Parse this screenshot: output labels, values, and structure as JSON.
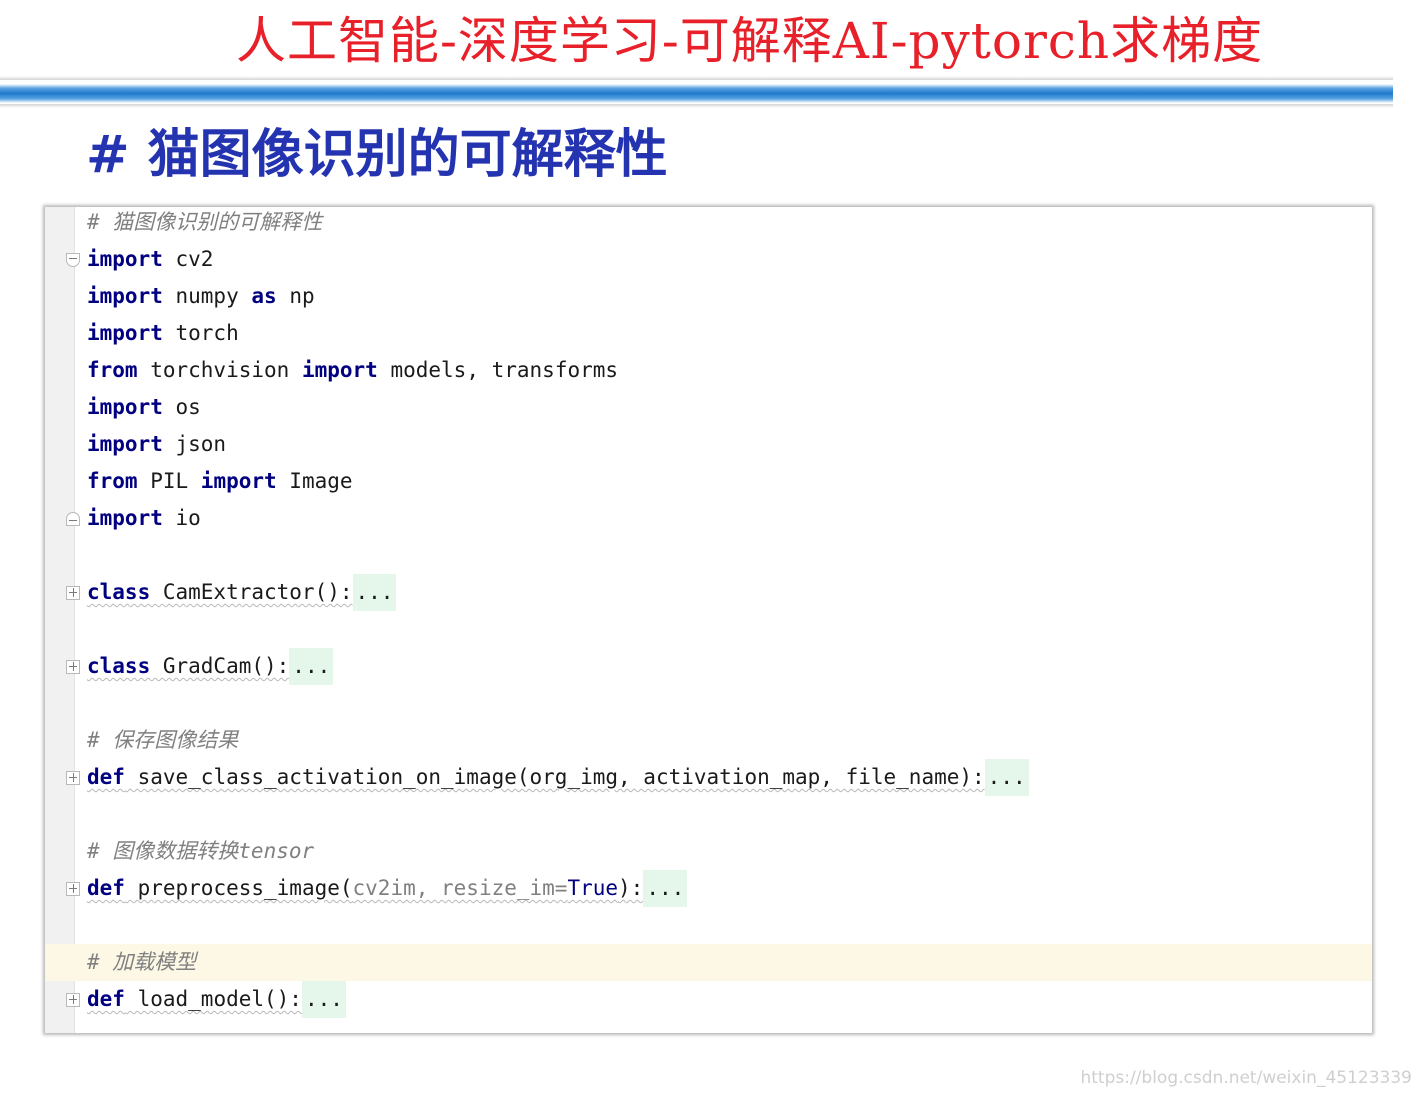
{
  "slide": {
    "title": "人工智能-深度学习-可解释AI-pytorch求梯度",
    "section_heading": "# 猫图像识别的可解释性",
    "watermark": "https://blog.csdn.net/weixin_45123339"
  },
  "editor": {
    "lines": [
      {
        "kind": "comment",
        "text": "# 猫图像识别的可解释性"
      },
      {
        "kind": "code",
        "fold": "open-start",
        "tokens": [
          {
            "t": "import",
            "c": "kw"
          },
          {
            "t": " cv2"
          }
        ]
      },
      {
        "kind": "code",
        "tokens": [
          {
            "t": "import",
            "c": "kw"
          },
          {
            "t": " numpy "
          },
          {
            "t": "as",
            "c": "kw"
          },
          {
            "t": " np"
          }
        ]
      },
      {
        "kind": "code",
        "tokens": [
          {
            "t": "import",
            "c": "kw"
          },
          {
            "t": " torch"
          }
        ]
      },
      {
        "kind": "code",
        "tokens": [
          {
            "t": "from",
            "c": "kw"
          },
          {
            "t": " torchvision "
          },
          {
            "t": "import",
            "c": "kw"
          },
          {
            "t": " models, transforms"
          }
        ]
      },
      {
        "kind": "code",
        "tokens": [
          {
            "t": "import",
            "c": "kw"
          },
          {
            "t": " os"
          }
        ]
      },
      {
        "kind": "code",
        "tokens": [
          {
            "t": "import",
            "c": "kw"
          },
          {
            "t": " json"
          }
        ]
      },
      {
        "kind": "code",
        "tokens": [
          {
            "t": "from",
            "c": "kw"
          },
          {
            "t": " PIL "
          },
          {
            "t": "import",
            "c": "kw"
          },
          {
            "t": " Image"
          }
        ]
      },
      {
        "kind": "code",
        "fold": "open-end",
        "tokens": [
          {
            "t": "import",
            "c": "kw"
          },
          {
            "t": " io"
          }
        ]
      },
      {
        "kind": "blank"
      },
      {
        "kind": "code",
        "fold": "collapsed",
        "squiggle": true,
        "tokens": [
          {
            "t": "class",
            "c": "kw"
          },
          {
            "t": " CamExtractor():"
          },
          {
            "t": "...",
            "c": "fold"
          }
        ]
      },
      {
        "kind": "blank"
      },
      {
        "kind": "code",
        "fold": "collapsed",
        "squiggle": true,
        "tokens": [
          {
            "t": "class",
            "c": "kw"
          },
          {
            "t": " GradCam():"
          },
          {
            "t": "...",
            "c": "fold"
          }
        ]
      },
      {
        "kind": "blank"
      },
      {
        "kind": "comment",
        "text": "# 保存图像结果"
      },
      {
        "kind": "code",
        "fold": "collapsed",
        "squiggle": true,
        "tokens": [
          {
            "t": "def",
            "c": "kw"
          },
          {
            "t": " save_class_activation_on_image(org_img, activation_map, file_name):"
          },
          {
            "t": "...",
            "c": "fold"
          }
        ]
      },
      {
        "kind": "blank"
      },
      {
        "kind": "comment",
        "text": "# 图像数据转换tensor"
      },
      {
        "kind": "code",
        "fold": "collapsed",
        "squiggle": true,
        "tokens": [
          {
            "t": "def",
            "c": "kw"
          },
          {
            "t": " preprocess_image("
          },
          {
            "t": "cv2im, resize_im=",
            "c": "param"
          },
          {
            "t": "True",
            "c": "const"
          },
          {
            "t": "):"
          },
          {
            "t": "...",
            "c": "fold"
          }
        ]
      },
      {
        "kind": "blank"
      },
      {
        "kind": "comment",
        "current": true,
        "text": "# 加载模型"
      },
      {
        "kind": "code",
        "fold": "collapsed",
        "squiggle": true,
        "tokens": [
          {
            "t": "def",
            "c": "kw"
          },
          {
            "t": " load_model():"
          },
          {
            "t": "...",
            "c": "fold"
          }
        ]
      }
    ]
  }
}
